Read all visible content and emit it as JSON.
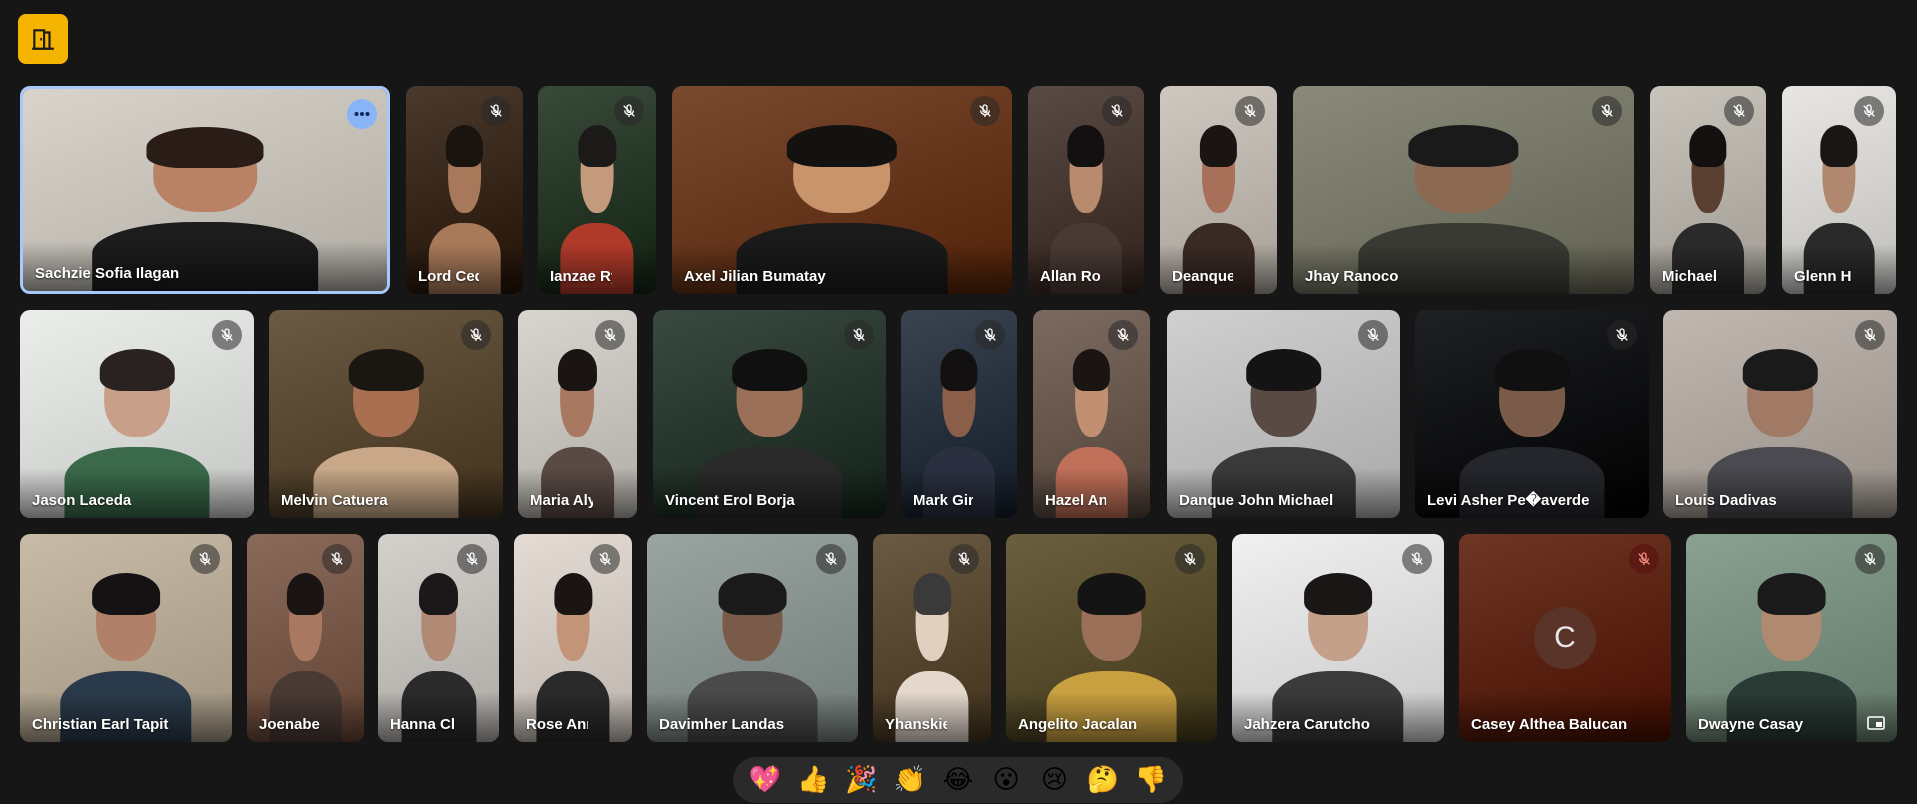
{
  "top_button": {
    "icon": "door-exit-icon",
    "color": "#f4b400"
  },
  "tiles_row1": [
    {
      "name": "Sachzie Sofia Ilagan",
      "muted": false,
      "active": true,
      "more": true,
      "bg": "#d8d4cc",
      "skin": "#b98264",
      "hair": "#2a1c16",
      "shirt": "#1c1c1c"
    },
    {
      "name": "Lord Ced...",
      "muted": true,
      "bg": "#4a3a2e",
      "skin": "#a8785a",
      "hair": "#1a1410",
      "shirt": "#a87a5a"
    },
    {
      "name": "Ianzae Ry...",
      "muted": true,
      "bg": "#3a4a3a",
      "skin": "#c49a7c",
      "hair": "#1c1a18",
      "shirt": "#b03a2a"
    },
    {
      "name": "Axel Jilian Bumatay",
      "muted": true,
      "bg": "#7a4a30",
      "skin": "#c8946c",
      "hair": "#141210",
      "shirt": "#1a1a1a"
    },
    {
      "name": "Allan Roi ...",
      "muted": true,
      "bg": "#5a4a44",
      "skin": "#b88a6e",
      "hair": "#121010",
      "shirt": "#4a3a34"
    },
    {
      "name": "Deanque...",
      "muted": true,
      "bg": "#cfc8c0",
      "skin": "#a87058",
      "hair": "#1a1412",
      "shirt": "#3a2a24"
    },
    {
      "name": "Jhay Ranoco",
      "muted": true,
      "bg": "#8a8a7a",
      "skin": "#8c6a52",
      "hair": "#1a1a1a",
      "shirt": "#3a3a34"
    },
    {
      "name": "Michael ...",
      "muted": true,
      "bg": "#c8c4bc",
      "skin": "#5a4030",
      "hair": "#141010",
      "shirt": "#2a2a2a"
    },
    {
      "name": "Glenn He...",
      "muted": true,
      "bg": "#e8e6e2",
      "skin": "#b08870",
      "hair": "#1a1616",
      "shirt": "#2a2a2a"
    }
  ],
  "tiles_row2": [
    {
      "name": "Jason Laceda",
      "muted": true,
      "bg": "#eceeec",
      "skin": "#c8a08a",
      "hair": "#2a2220",
      "shirt": "#3a6a4a"
    },
    {
      "name": "Melvin Catuera",
      "muted": true,
      "bg": "#6a5a44",
      "skin": "#a87050",
      "hair": "#1a1612",
      "shirt": "#c8a888"
    },
    {
      "name": "Maria Aly...",
      "muted": true,
      "bg": "#d8d4ce",
      "skin": "#a87860",
      "hair": "#1a1412",
      "shirt": "#5a4a44"
    },
    {
      "name": "Vincent Erol Borja",
      "muted": true,
      "bg": "#3a4a40",
      "skin": "#9a7058",
      "hair": "#101010",
      "shirt": "#2a2a2a"
    },
    {
      "name": "Mark Gir...",
      "muted": true,
      "bg": "#3a4450",
      "skin": "#8a5e48",
      "hair": "#121010",
      "shirt": "#2a3040"
    },
    {
      "name": "Hazel An...",
      "muted": true,
      "bg": "#7a6a60",
      "skin": "#c09070",
      "hair": "#1a1412",
      "shirt": "#c07058"
    },
    {
      "name": "Danque John Michael",
      "muted": true,
      "bg": "#d0d0d0",
      "skin": "#5a4a44",
      "hair": "#141414",
      "shirt": "#3a3a3a"
    },
    {
      "name": "Levi Asher Pe�averde",
      "muted": true,
      "bg": "#1e2024",
      "skin": "#7a5a48",
      "hair": "#101010",
      "shirt": "#24262c"
    },
    {
      "name": "Louis Dadivas",
      "muted": true,
      "bg": "#c0b8b0",
      "skin": "#a07a64",
      "hair": "#1a1a1a",
      "shirt": "#4a4a50"
    }
  ],
  "tiles_row3": [
    {
      "name": "Christian Earl Tapit",
      "muted": true,
      "bg": "#c8bca8",
      "skin": "#b08068",
      "hair": "#141212",
      "shirt": "#2a3a4a"
    },
    {
      "name": "Joenabel...",
      "muted": true,
      "bg": "#8a6a5a",
      "skin": "#a87860",
      "hair": "#1a1412",
      "shirt": "#4a3a34"
    },
    {
      "name": "Hanna Cl...",
      "muted": true,
      "bg": "#d4d0cc",
      "skin": "#b08a74",
      "hair": "#1a1818",
      "shirt": "#2a2a2a"
    },
    {
      "name": "Rose Ann...",
      "muted": true,
      "bg": "#e4dcd4",
      "skin": "#c49478",
      "hair": "#1a1412",
      "shirt": "#2a2a2a"
    },
    {
      "name": "Davimher Landas",
      "muted": true,
      "bg": "#9aa4a0",
      "skin": "#7a5a48",
      "hair": "#1a1a1a",
      "shirt": "#4a4a4a"
    },
    {
      "name": "Yhanskie ...",
      "muted": true,
      "bg": "#6a5a44",
      "skin": "#e0d0c0",
      "hair": "#3a3a3a",
      "shirt": "#e4d8cc"
    },
    {
      "name": "Angelito Jacalan",
      "muted": true,
      "bg": "#6a6040",
      "skin": "#9a7058",
      "hair": "#141414",
      "shirt": "#c8a040"
    },
    {
      "name": "Jahzera Carutcho",
      "muted": true,
      "bg": "#f0f0f0",
      "skin": "#c4a08a",
      "hair": "#1a1616",
      "shirt": "#3a3a3a"
    },
    {
      "name": "Casey Althea Balucan",
      "muted": true,
      "avatar": "C",
      "bg": "#6e3624"
    },
    {
      "name": "Dwayne Casay",
      "muted": true,
      "pin": true,
      "bg": "#8aa090",
      "skin": "#b08a70",
      "hair": "#1a1a1a",
      "shirt": "#2a3a34"
    }
  ],
  "reactions": [
    {
      "emoji": "💖",
      "label": "sparkling-heart"
    },
    {
      "emoji": "👍",
      "label": "thumbs-up"
    },
    {
      "emoji": "🎉",
      "label": "party-popper"
    },
    {
      "emoji": "👏",
      "label": "clapping-hands"
    },
    {
      "emoji": "😂",
      "label": "tears-of-joy"
    },
    {
      "emoji": "😮",
      "label": "surprised"
    },
    {
      "emoji": "😢",
      "label": "crying"
    },
    {
      "emoji": "🤔",
      "label": "thinking"
    },
    {
      "emoji": "👎",
      "label": "thumbs-down"
    }
  ]
}
